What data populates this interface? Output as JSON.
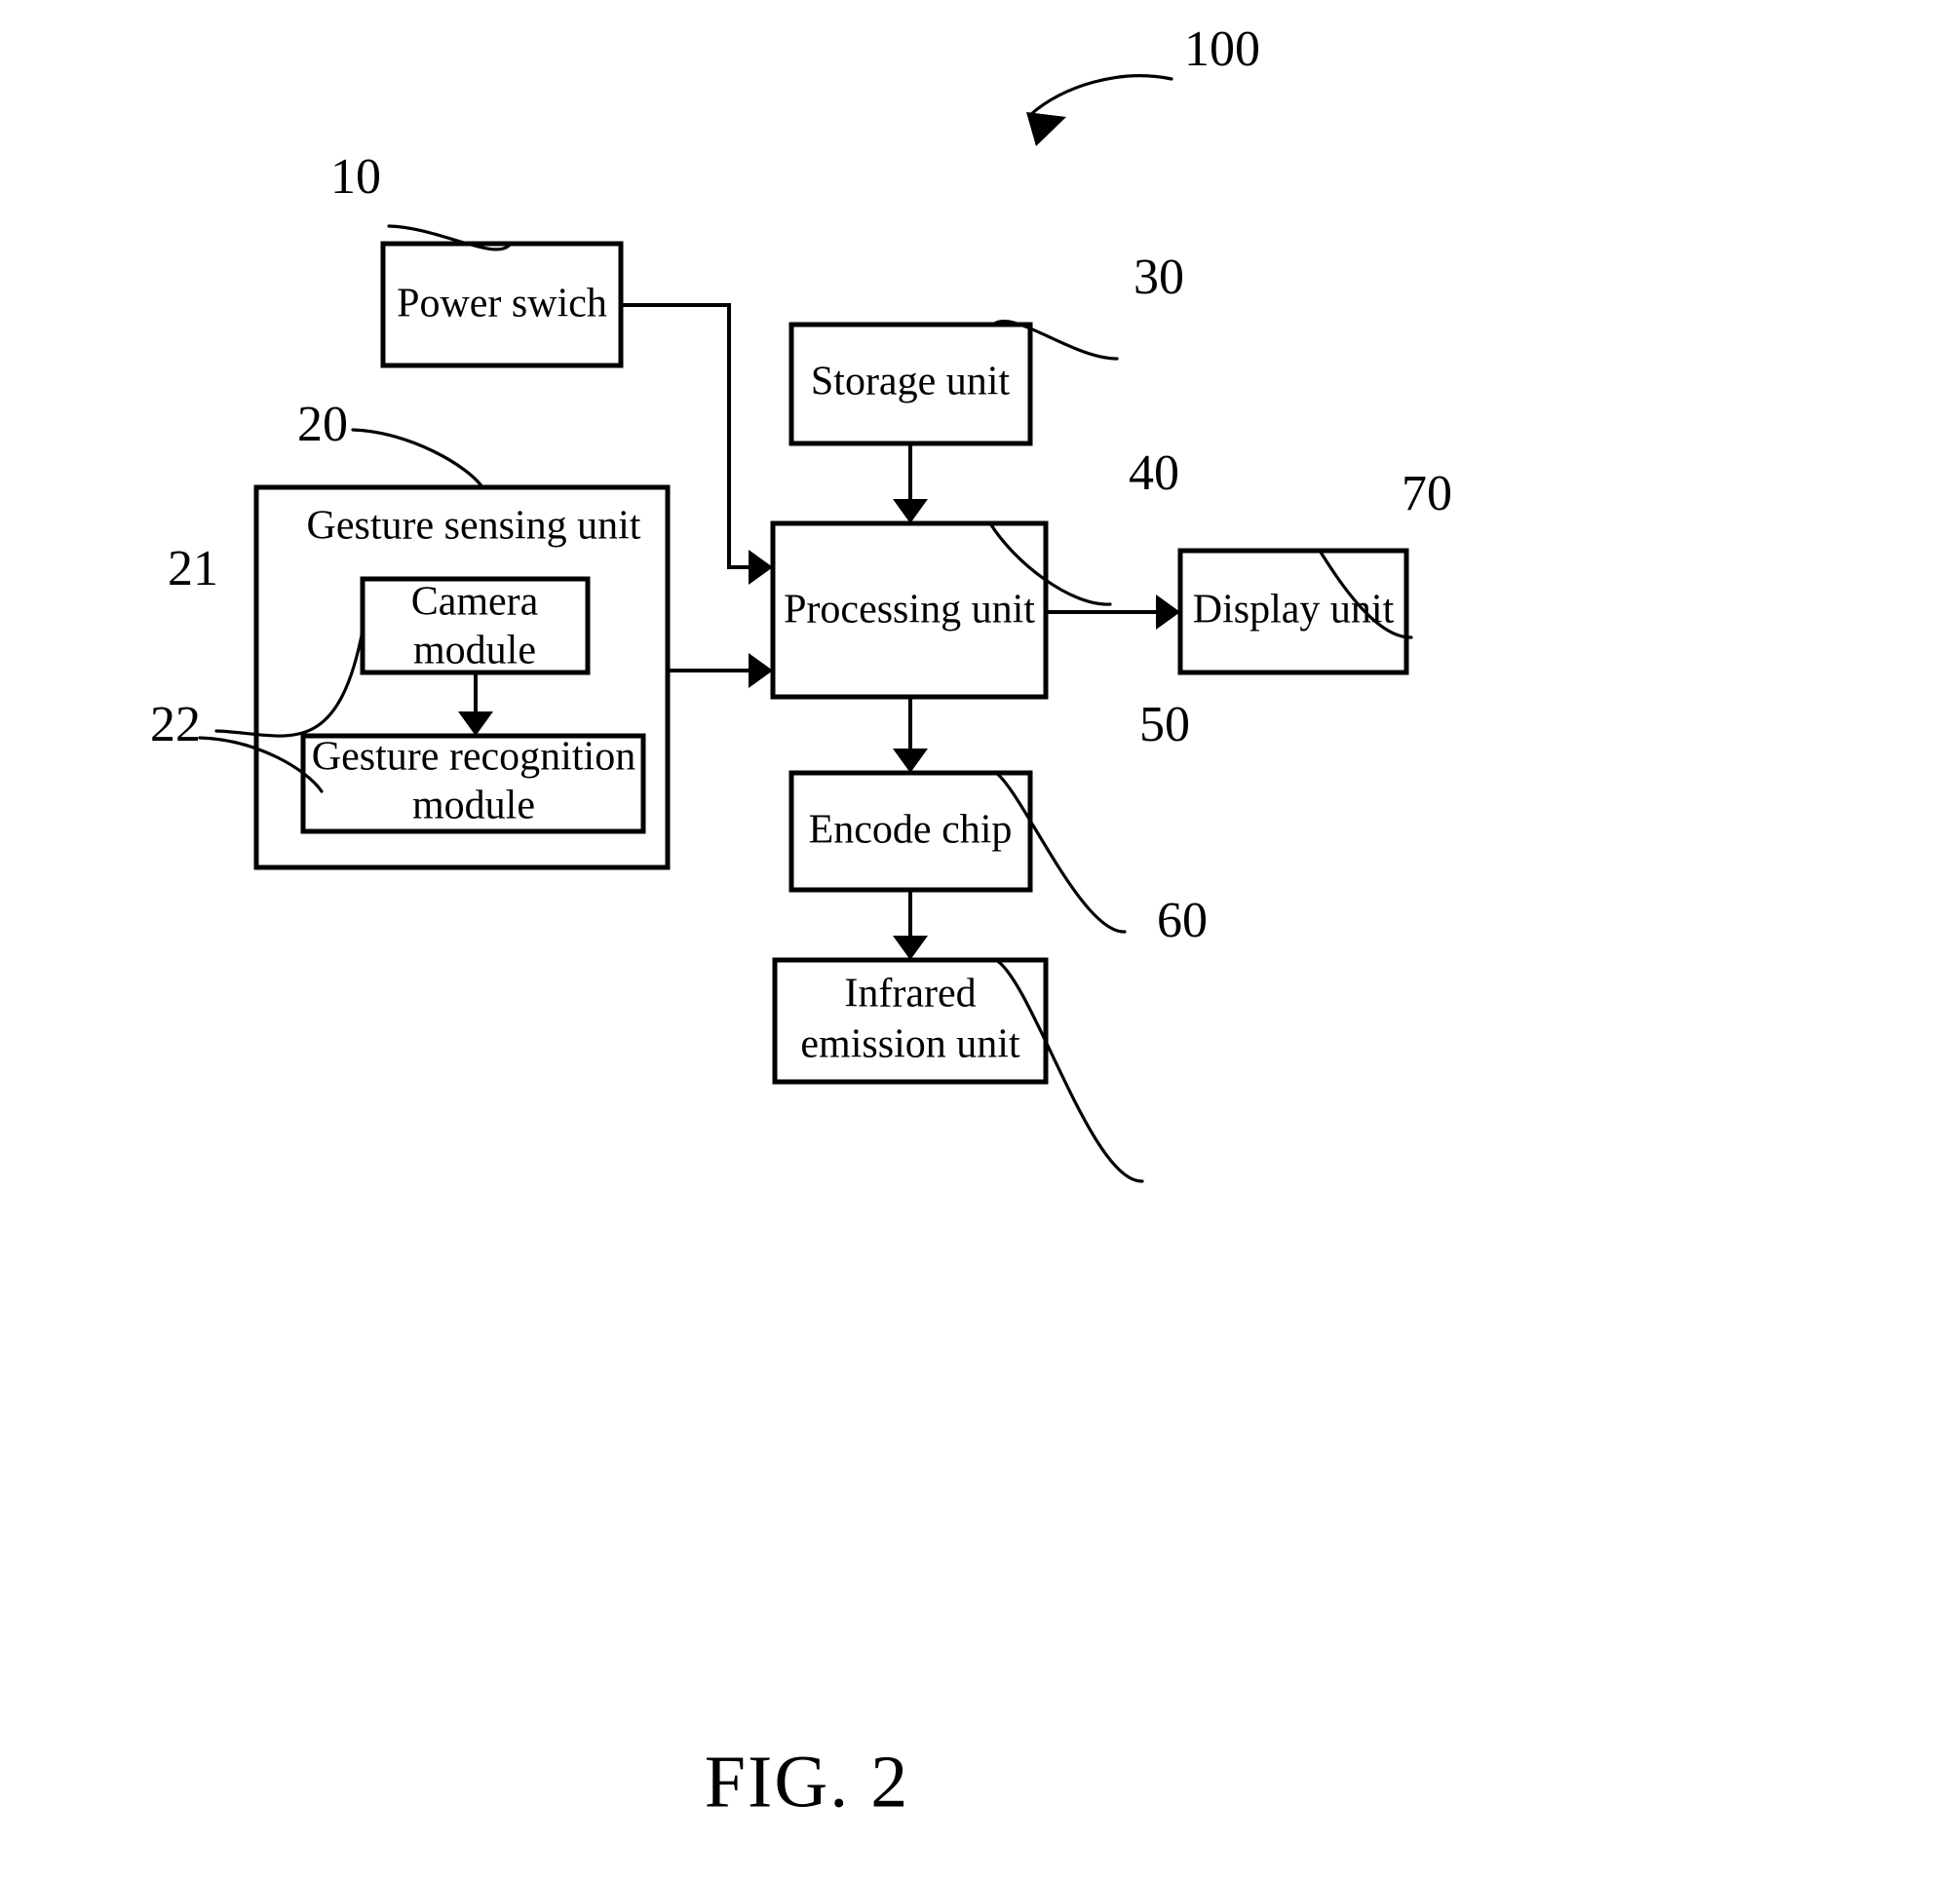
{
  "figure": {
    "caption": "FIG. 2",
    "system_reference": "100"
  },
  "blocks": {
    "power_switch": {
      "label": "Power swich",
      "ref": "10"
    },
    "gesture_sensing_unit": {
      "label": "Gesture sensing unit",
      "ref": "20"
    },
    "camera_module": {
      "label_line1": "Camera",
      "label_line2": "module",
      "ref": "21"
    },
    "gesture_recognition_module": {
      "label_line1": "Gesture recognition",
      "label_line2": "module",
      "ref": "22"
    },
    "storage_unit": {
      "label": "Storage unit",
      "ref": "30"
    },
    "processing_unit": {
      "label": "Processing unit",
      "ref": "40"
    },
    "encode_chip": {
      "label": "Encode chip",
      "ref": "50"
    },
    "infrared_emission_unit": {
      "label_line1": "Infrared",
      "label_line2": "emission unit",
      "ref": "60"
    },
    "display_unit": {
      "label": "Display unit",
      "ref": "70"
    }
  },
  "connections": [
    {
      "from": "power_switch",
      "to": "processing_unit",
      "style": "orthogonal-right-down",
      "arrow": true
    },
    {
      "from": "gesture_sensing_unit",
      "to": "processing_unit",
      "style": "horizontal",
      "arrow": true
    },
    {
      "from": "storage_unit",
      "to": "processing_unit",
      "style": "vertical",
      "arrow": true
    },
    {
      "from": "processing_unit",
      "to": "display_unit",
      "style": "horizontal",
      "arrow": true
    },
    {
      "from": "processing_unit",
      "to": "encode_chip",
      "style": "vertical",
      "arrow": true
    },
    {
      "from": "encode_chip",
      "to": "infrared_emission_unit",
      "style": "vertical",
      "arrow": true
    },
    {
      "from": "camera_module",
      "to": "gesture_recognition_module",
      "style": "vertical",
      "arrow": true
    }
  ],
  "colors": {
    "background": "#ffffff",
    "ink": "#000000"
  }
}
